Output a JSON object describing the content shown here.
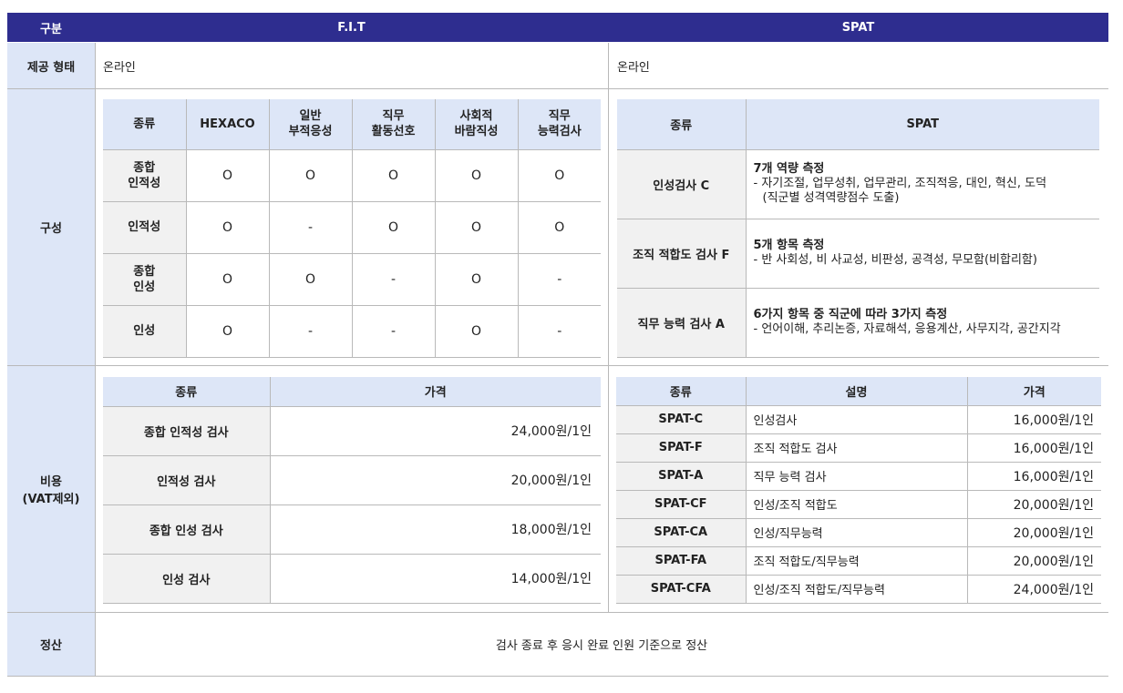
{
  "header": {
    "col_label": "구분",
    "fit_title": "F.I.T",
    "spat_title": "SPAT"
  },
  "provision": {
    "label": "제공 형태",
    "fit_value": "온라인",
    "spat_value": "온라인"
  },
  "composition": {
    "label": "구성",
    "fit": {
      "headers": [
        "종류",
        "HEXACO",
        "일반\n부적응성",
        "직무\n활동선호",
        "사회적\n바람직성",
        "직무\n능력검사"
      ],
      "rows": [
        {
          "name": "종합\n인적성",
          "cells": [
            "O",
            "O",
            "O",
            "O",
            "O"
          ]
        },
        {
          "name": "인적성",
          "cells": [
            "O",
            "-",
            "O",
            "O",
            "O"
          ]
        },
        {
          "name": "종합\n인성",
          "cells": [
            "O",
            "O",
            "-",
            "O",
            "-"
          ]
        },
        {
          "name": "인성",
          "cells": [
            "O",
            "-",
            "-",
            "O",
            "-"
          ]
        }
      ]
    },
    "spat": {
      "headers": [
        "종류",
        "SPAT"
      ],
      "rows": [
        {
          "name": "인성검사 C",
          "title": "7개 역량 측정",
          "detail": "- 자기조절, 업무성취, 업무관리, 조직적응, 대인, 혁신, 도덕",
          "detail2": "(직군별 성격역량점수 도출)"
        },
        {
          "name": "조직 적합도 검사 F",
          "title": "5개 항목 측정",
          "detail": "- 반 사회성, 비 사교성, 비판성, 공격성, 무모함(비합리함)",
          "detail2": ""
        },
        {
          "name": "직무 능력 검사 A",
          "title": "6가지 항목 중 직군에 따라 3가지 측정",
          "detail": "- 언어이해, 추리논증, 자료해석, 응용계산, 사무지각, 공간지각",
          "detail2": ""
        }
      ]
    }
  },
  "cost": {
    "label": "비용\n(VAT제외)",
    "fit": {
      "headers": [
        "종류",
        "가격"
      ],
      "rows": [
        {
          "name": "종합 인적성 검사",
          "price": "24,000원/1인"
        },
        {
          "name": "인적성 검사",
          "price": "20,000원/1인"
        },
        {
          "name": "종합 인성 검사",
          "price": "18,000원/1인"
        },
        {
          "name": "인성 검사",
          "price": "14,000원/1인"
        }
      ]
    },
    "spat": {
      "headers": [
        "종류",
        "설명",
        "가격"
      ],
      "rows": [
        {
          "name": "SPAT-C",
          "desc": "인성검사",
          "price": "16,000원/1인"
        },
        {
          "name": "SPAT-F",
          "desc": "조직 적합도 검사",
          "price": "16,000원/1인"
        },
        {
          "name": "SPAT-A",
          "desc": "직무 능력 검사",
          "price": "16,000원/1인"
        },
        {
          "name": "SPAT-CF",
          "desc": "인성/조직 적합도",
          "price": "20,000원/1인"
        },
        {
          "name": "SPAT-CA",
          "desc": "인성/직무능력",
          "price": "20,000원/1인"
        },
        {
          "name": "SPAT-FA",
          "desc": "조직 적합도/직무능력",
          "price": "20,000원/1인"
        },
        {
          "name": "SPAT-CFA",
          "desc": "인성/조직 적합도/직무능력",
          "price": "24,000원/1인"
        }
      ]
    }
  },
  "settlement": {
    "label": "정산",
    "value": "검사 종료 후 응시 완료 인원 기준으로 정산"
  }
}
